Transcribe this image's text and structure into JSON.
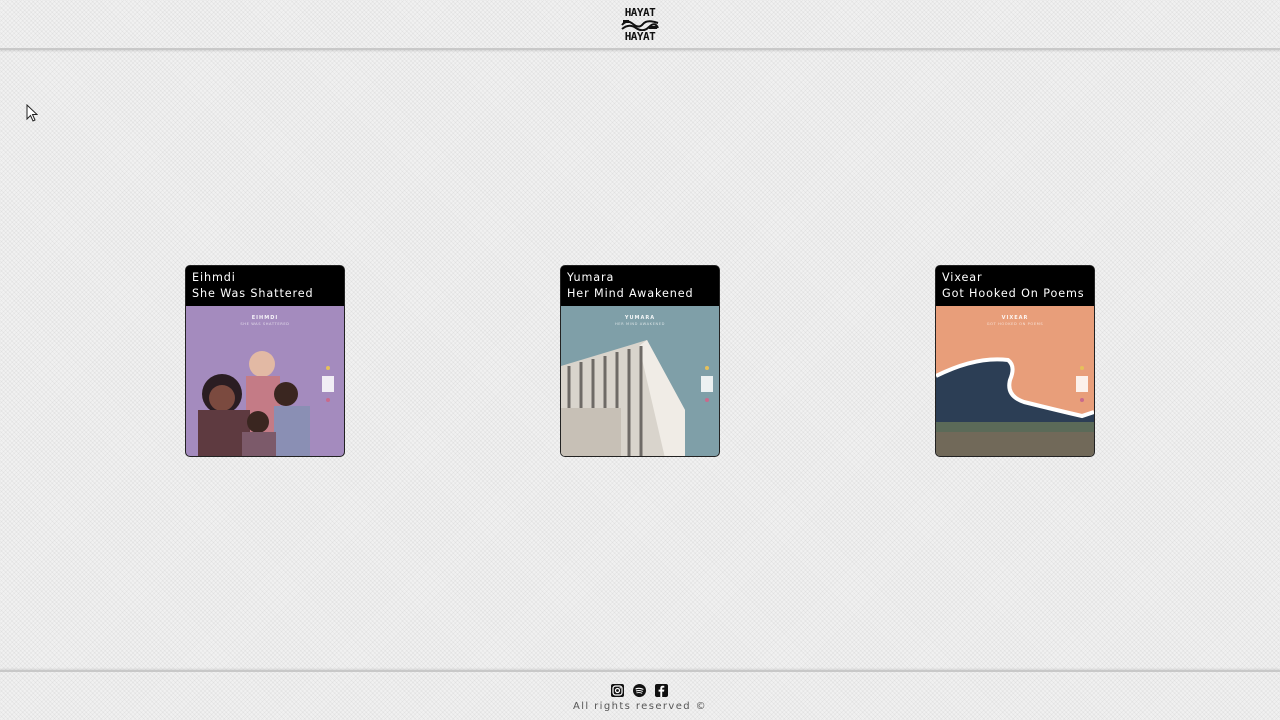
{
  "header": {
    "logo_text": "HAYAT",
    "logo_alt": "HAYAT logo"
  },
  "releases": [
    {
      "artist": "Eihmdi",
      "title": "She Was Shattered",
      "cover_text": "EIHMDI",
      "cover_sub": "SHE WAS SHATTERED",
      "cover_color": "#a48bbe"
    },
    {
      "artist": "Yumara",
      "title": "Her Mind Awakened",
      "cover_text": "YUMARA",
      "cover_sub": "HER MIND AWAKENED",
      "cover_color": "#7f9fa8"
    },
    {
      "artist": "Vixear",
      "title": "Got Hooked On Poems",
      "cover_text": "VIXEAR",
      "cover_sub": "GOT HOOKED ON POEMS",
      "cover_color": "#e89e7a"
    }
  ],
  "footer": {
    "social": [
      {
        "icon": "instagram-icon"
      },
      {
        "icon": "spotify-icon"
      },
      {
        "icon": "facebook-icon"
      }
    ],
    "copyright": "All rights reserved ©"
  }
}
